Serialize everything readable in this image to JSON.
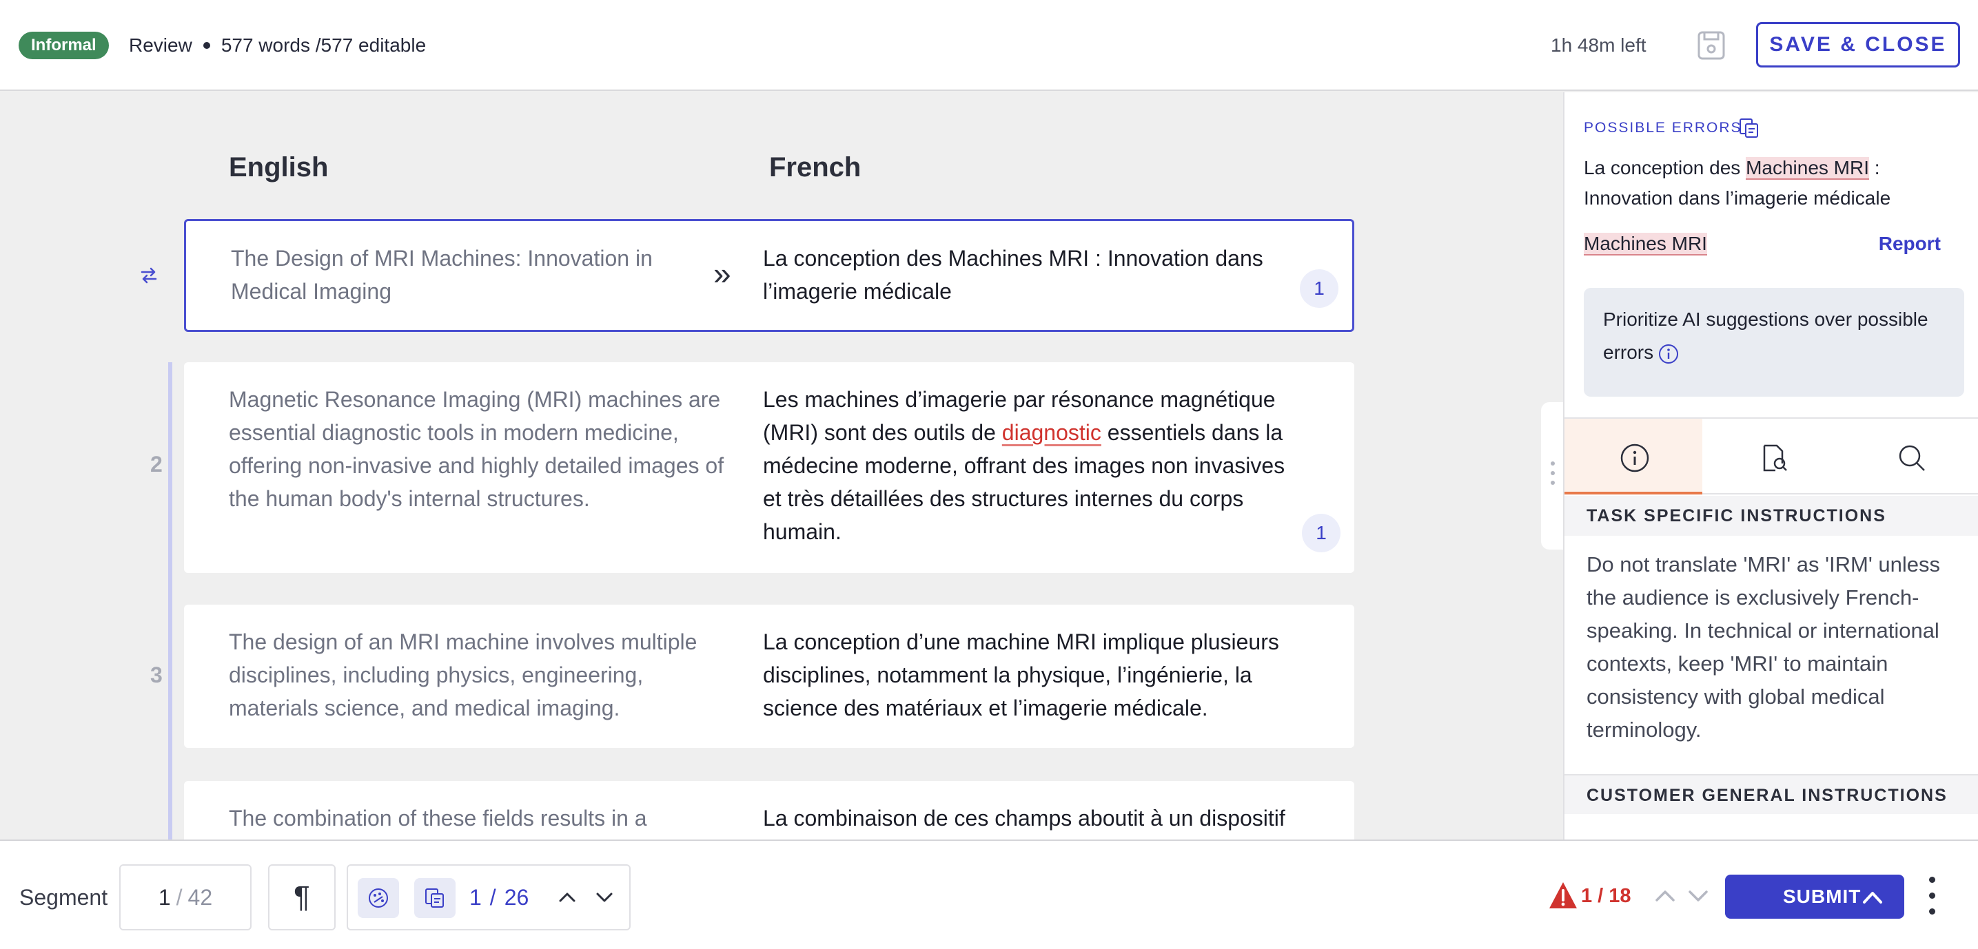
{
  "header": {
    "register_badge": "Informal",
    "review_label": "Review",
    "word_stats": "577 words /577 editable",
    "time_left": "1h 48m left",
    "save_close_label": "SAVE & CLOSE"
  },
  "columns": {
    "source_language": "English",
    "target_language": "French"
  },
  "segments": [
    {
      "number": "",
      "source": "The Design of MRI Machines: Innovation in Medical Imaging",
      "target": "La conception des Machines MRI : Innovation dans l’imagerie médicale",
      "issue_count": "1"
    },
    {
      "number": "2",
      "source": "Magnetic Resonance Imaging (MRI) machines are essential diagnostic tools in modern medicine, offering non-invasive and highly detailed images of the human body's internal structures.",
      "target_before": "Les machines d’imagerie par résonance magnétique (MRI) sont des outils de ",
      "target_error": "diagnostic",
      "target_after": " essentiels dans la médecine moderne, offrant des images non invasives et très détaillées des structures internes du corps humain.",
      "issue_count": "1"
    },
    {
      "number": "3",
      "source": "The design of an MRI machine involves multiple disciplines, including physics, engineering, materials science, and medical imaging.",
      "target": "La conception d’une machine MRI implique plusieurs disciplines, notamment la physique, l’ingénierie, la science des matériaux et l’imagerie médicale."
    },
    {
      "number": "",
      "source": "The combination of these fields results in a",
      "target": "La combinaison de ces champs aboutit à un dispositif"
    }
  ],
  "sidebar": {
    "possible_errors_label": "POSSIBLE ERRORS",
    "sentence_before": "La conception des ",
    "sentence_highlight": "Machines MRI",
    "sentence_after": " : Innovation dans l’imagerie médicale",
    "flagged_term": "Machines MRI",
    "report_label": "Report",
    "prioritize_text": "Prioritize AI suggestions over possible errors",
    "tabs": [
      {
        "icon": "info-icon",
        "active": true
      },
      {
        "icon": "document-search-icon",
        "active": false
      },
      {
        "icon": "search-icon",
        "active": false
      }
    ],
    "task_instructions_heading": "TASK SPECIFIC INSTRUCTIONS",
    "task_instructions_text": "Do not translate 'MRI' as 'IRM' unless the audience is exclusively French-speaking. In technical or international contexts, keep 'MRI' to maintain consistency with global medical terminology.",
    "customer_instructions_heading": "CUSTOMER GENERAL INSTRUCTIONS"
  },
  "footer": {
    "segment_label": "Segment",
    "segment_current": "1",
    "segment_total": "42",
    "pilcrow": "¶",
    "issue_position": "1",
    "issue_total": "26",
    "error_position": "1",
    "error_total": "18",
    "submit_label": "SUBMIT"
  },
  "colors": {
    "accent": "#3a3fc7",
    "badge_green": "#3f8a5a",
    "error_red": "#d0332e",
    "active_tab_underline": "#e8794a"
  }
}
